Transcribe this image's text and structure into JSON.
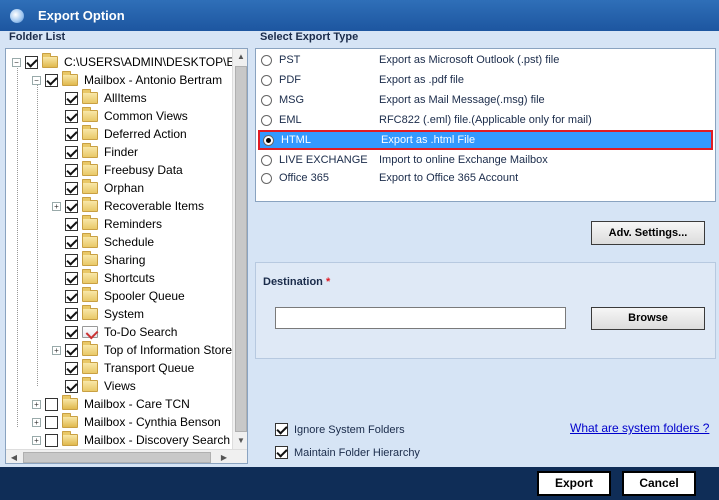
{
  "window": {
    "title": "Export Option"
  },
  "folder_list": {
    "label": "Folder List",
    "items": [
      {
        "label": "C:\\USERS\\ADMIN\\DESKTOP\\ED",
        "level": 0,
        "expander": "-",
        "checked": true,
        "kind": "pst"
      },
      {
        "label": "Mailbox - Antonio Bertram",
        "level": 1,
        "expander": "-",
        "checked": true,
        "kind": "mailbox"
      },
      {
        "label": "AllItems",
        "level": 2,
        "expander": "",
        "checked": true,
        "kind": "folder"
      },
      {
        "label": "Common Views",
        "level": 2,
        "expander": "",
        "checked": true,
        "kind": "folder"
      },
      {
        "label": "Deferred Action",
        "level": 2,
        "expander": "",
        "checked": true,
        "kind": "folder"
      },
      {
        "label": "Finder",
        "level": 2,
        "expander": "",
        "checked": true,
        "kind": "folder"
      },
      {
        "label": "Freebusy Data",
        "level": 2,
        "expander": "",
        "checked": true,
        "kind": "folder"
      },
      {
        "label": "Orphan",
        "level": 2,
        "expander": "",
        "checked": true,
        "kind": "folder"
      },
      {
        "label": "Recoverable Items",
        "level": 2,
        "expander": "+",
        "checked": true,
        "kind": "folder"
      },
      {
        "label": "Reminders",
        "level": 2,
        "expander": "",
        "checked": true,
        "kind": "folder"
      },
      {
        "label": "Schedule",
        "level": 2,
        "expander": "",
        "checked": true,
        "kind": "folder"
      },
      {
        "label": "Sharing",
        "level": 2,
        "expander": "",
        "checked": true,
        "kind": "folder"
      },
      {
        "label": "Shortcuts",
        "level": 2,
        "expander": "",
        "checked": true,
        "kind": "folder"
      },
      {
        "label": "Spooler Queue",
        "level": 2,
        "expander": "",
        "checked": true,
        "kind": "folder"
      },
      {
        "label": "System",
        "level": 2,
        "expander": "",
        "checked": true,
        "kind": "folder"
      },
      {
        "label": "To-Do Search",
        "level": 2,
        "expander": "",
        "checked": true,
        "kind": "todo"
      },
      {
        "label": "Top of Information Store",
        "level": 2,
        "expander": "+",
        "checked": true,
        "kind": "folder"
      },
      {
        "label": "Transport Queue",
        "level": 2,
        "expander": "",
        "checked": true,
        "kind": "folder"
      },
      {
        "label": "Views",
        "level": 2,
        "expander": "",
        "checked": true,
        "kind": "folder"
      },
      {
        "label": "Mailbox - Care TCN",
        "level": 1,
        "expander": "+",
        "checked": false,
        "kind": "mailbox"
      },
      {
        "label": "Mailbox - Cynthia Benson",
        "level": 1,
        "expander": "+",
        "checked": false,
        "kind": "mailbox"
      },
      {
        "label": "Mailbox - Discovery Search M",
        "level": 1,
        "expander": "+",
        "checked": false,
        "kind": "mailbox"
      }
    ]
  },
  "export_type": {
    "label": "Select Export Type",
    "selected_index": 4,
    "options": [
      {
        "type": "PST",
        "desc": "Export as Microsoft Outlook (.pst) file"
      },
      {
        "type": "PDF",
        "desc": "Export as .pdf file"
      },
      {
        "type": "MSG",
        "desc": "Export as Mail Message(.msg) file"
      },
      {
        "type": "EML",
        "desc": "RFC822 (.eml) file.(Applicable only for mail)"
      },
      {
        "type": "HTML",
        "desc": "Export as .html File"
      },
      {
        "type": "LIVE EXCHANGE",
        "desc": "Import to online Exchange Mailbox"
      },
      {
        "type": "Office 365",
        "desc": "Export to Office 365 Account"
      }
    ]
  },
  "adv_settings": {
    "label": "Adv. Settings..."
  },
  "destination": {
    "label": "Destination",
    "required_mark": "*",
    "value": "",
    "browse_label": "Browse"
  },
  "options": {
    "ignore_system": {
      "label": "Ignore System Folders",
      "checked": true
    },
    "maintain_hierarchy": {
      "label": "Maintain Folder Hierarchy",
      "checked": true
    },
    "system_folders_link": "What are system folders ?"
  },
  "footer": {
    "export_label": "Export",
    "cancel_label": "Cancel"
  }
}
